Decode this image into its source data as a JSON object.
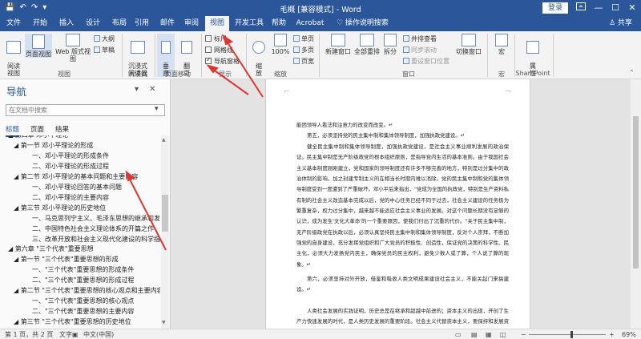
{
  "window": {
    "title": "毛概 [兼容模式] - Word",
    "login_label": "登录",
    "restore_icon": "ribbon-display-icon",
    "min_label": "—",
    "max_label": "☐",
    "close_label": "✕"
  },
  "quick_access": {
    "save_label": "💾",
    "undo_label": "↶",
    "redo_label": "↷",
    "customize_label": "▾"
  },
  "tabs": [
    {
      "label": "文件"
    },
    {
      "label": "开始"
    },
    {
      "label": "插入"
    },
    {
      "label": "设计"
    },
    {
      "label": "布局"
    },
    {
      "label": "引用"
    },
    {
      "label": "邮件"
    },
    {
      "label": "审阅"
    },
    {
      "label": "视图"
    },
    {
      "label": "开发工具"
    },
    {
      "label": "帮助"
    },
    {
      "label": "Acrobat"
    }
  ],
  "active_tab": "视图",
  "tell_me": "♡ 操作说明搜索",
  "share": "♙ 共享",
  "ribbon": {
    "views": {
      "read_mode": "阅读\n视图",
      "print_layout": "页面视图",
      "web_layout": "Web 版式视图",
      "outline": "大纲",
      "draft": "草稿",
      "group": "视图"
    },
    "immersive": {
      "reader": "沉浸式\n阅读器",
      "group": "沉浸式"
    },
    "page_movement": {
      "vertical": "垂\n直",
      "side_to_side": "翻\n页",
      "group": "页面移动"
    },
    "show": {
      "ruler": "标尺",
      "gridlines": "网格线",
      "nav_pane": "导航窗格",
      "group": "显示",
      "ruler_checked": false,
      "gridlines_checked": false,
      "nav_pane_checked": true
    },
    "zoom": {
      "zoom": "缩\n放",
      "percent": "100%",
      "one_page": "单页",
      "multiple_pages": "多页",
      "page_width": "页宽",
      "group": "缩放"
    },
    "window": {
      "new_window": "新建窗口",
      "arrange_all": "全部重排",
      "split": "拆分",
      "side_by_side": "并排查看",
      "sync_scroll": "同步滚动",
      "reset_position": "重设窗口位置",
      "switch_windows": "切换窗口",
      "group": "窗口"
    },
    "macros": {
      "macros": "宏",
      "group": "宏"
    },
    "sharepoint": {
      "properties": "属\n性",
      "group": "SharePoint"
    }
  },
  "nav": {
    "title": "导航",
    "search_placeholder": "在文档中搜索",
    "tabs": [
      "标题",
      "页面",
      "结果"
    ],
    "nodes": [
      {
        "text": "◢ 第四章 邓小平理论",
        "level": 0
      },
      {
        "text": "◢ 第一节 邓小平理论的形成",
        "level": 1
      },
      {
        "text": "一、邓小平理论的形成条件",
        "level": 2
      },
      {
        "text": "二、邓小平理论的形成过程",
        "level": 2
      },
      {
        "text": "◢ 第二节 邓小平理论的基本问题和主要内容",
        "level": 1
      },
      {
        "text": "一、邓小平理论回答的基本问题",
        "level": 2
      },
      {
        "text": "二、邓小平理论的主要内容",
        "level": 2
      },
      {
        "text": "◢ 第三节 邓小平理论的历史地位",
        "level": 1
      },
      {
        "text": "一、马克思列宁主义、毛泽东思想的继承和发展",
        "level": 2
      },
      {
        "text": "二、中国特色社会主义理论体系的开篇之作",
        "level": 2
      },
      {
        "text": "三、改革开放和社会主义现代化建设的科学指南",
        "level": 2
      },
      {
        "text": "◢ 第六章 \"三个代表\"重要思想",
        "level": 0
      },
      {
        "text": "◢ 第一节 \"三个代表\"重要思想的形成",
        "level": 1
      },
      {
        "text": "一、\"三个代表\"重要思想的形成条件",
        "level": 2
      },
      {
        "text": "二、\"三个代表\"重要思想的形成过程",
        "level": 2
      },
      {
        "text": "◢ 第二节 \"三个代表\"重要思想的核心观点和主要内容",
        "level": 1
      },
      {
        "text": "一、\"三个代表\"重要思想的核心观点",
        "level": 2
      },
      {
        "text": "二、\"三个代表\"重要思想的主要内容",
        "level": 2
      },
      {
        "text": "◢ 第三节 \"三个代表\"重要思想的历史地位",
        "level": 1
      }
    ]
  },
  "document": {
    "paragraphs": [
      "能团领导人看法和注意力的改变而改变。↵",
      "第五，必须坚持党的民主集中制和集体领导制度，加强执政党建设。↵",
      "健全民主集中制和集体领导制度，加强执政党建设，是社会主义事业顺利发展的政治保证。民主集中制是无产阶级政党的根本组织原则，是指导党内生活的基本准则。由于我国社会主义基本制度刚刚建立，党和国家的领导制度还有许多不够完善的地方，特别是过分集中的政治体制的影响，加之封建专制主义的在相当长时期内难以消除，党的民主集中制和党的集体领导制度受到一度遭到了严重破坏。邓小平后来指出，\"党成为全国的执政党，特别是生产资料私有制的社会主义改造基本完成以后，党的中心任务已经不同于过去，社会主义建设的任务极为繁重复杂，权力过分集中，越来越不能适应社会主义事业的发展。对这个问题长期没有足够的认识，成为发生'文化大革命'的一个重要原因，使我们付出了沉重的代价。\"关于民主集中制，无产阶级政党在执政以后，必须认真坚持民主集中制和集体领导制度，反对个人崇拜，不断加强党的自身建设，充分发挥党组织和广大党员的积极性、创造性，保证党的决策的科学性、民主化，必须大力发扬党内民主，确保党员的民主权利，避免少数人或了算，个人说了算的现象。↵",
      "第六，必须坚持对外开放，借鉴和吸收人类文明成果建设社会主义，不能关起门来搞建设。↵",
      "人类社会发展的实践证明，历史总是在继承和超越中前进的；资本主义的出现，开创了生产力快速发展的时代，是人类历史发展的重要阶段。社会主义代替资本主义，要保持和发展资本主义所创造的文明成果，尤其是资本主义的生产力和先进的科学技术。"
    ]
  },
  "status": {
    "page": "第 1 页，共 2 页",
    "words": "文字",
    "proofing_icon": "proofing-icon",
    "language": "中文(中国)",
    "zoom": "69%"
  }
}
